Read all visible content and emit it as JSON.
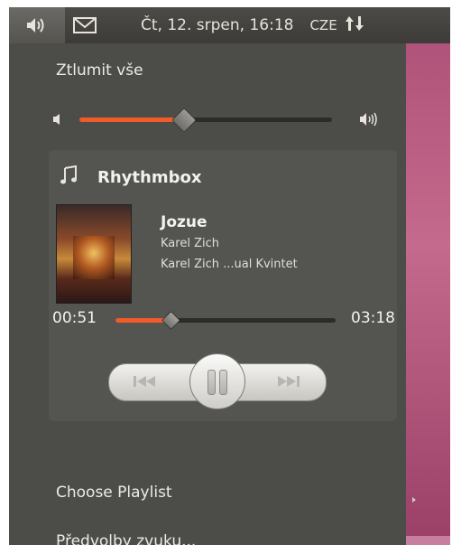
{
  "panel": {
    "sound_icon": "speaker-icon",
    "mail_icon": "envelope-icon",
    "clock": "Čt, 12. srpen, 16:18",
    "keyboard_layout": "CZE",
    "network_icon": "network-updown-icon"
  },
  "menu": {
    "mute_label": "Ztlumit vše",
    "volume_level": 0.4,
    "player": {
      "name": "Rhythmbox",
      "icon": "music-note-icon",
      "song_title": "Jozue",
      "artist": "Karel Zich",
      "album": "Karel Zich ...ual Kvintet",
      "time_current": "00:51",
      "time_total": "03:18",
      "progress": 0.24
    },
    "choose_playlist_label": "Choose Playlist",
    "sound_prefs_label": "Předvolby zvuku..."
  },
  "colors": {
    "accent": "#f15a29",
    "panel_bg": "#3c3b37",
    "menu_bg": "#4c4c49"
  }
}
